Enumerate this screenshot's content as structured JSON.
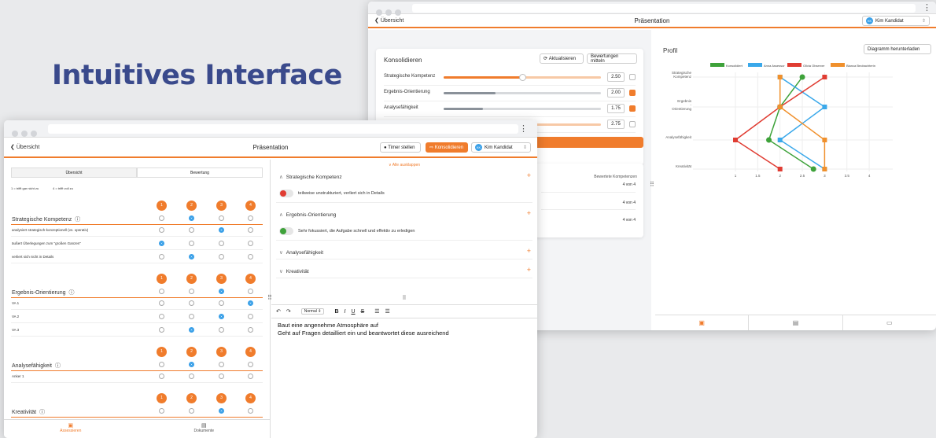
{
  "hero_title": "Intuitives Interface",
  "back_win": {
    "back_label": "Übersicht",
    "title": "Präsentation",
    "candidate": "Kim Kandidat",
    "candidate_initials": "KK",
    "konsolidieren": {
      "heading": "Konsolidieren",
      "btn_update": "Aktualisieren",
      "btn_average": "Bewertungen mitteln",
      "rows": [
        {
          "label": "Strategische Kompetenz",
          "value": "2.50",
          "checked": false,
          "fill": 0.5
        },
        {
          "label": "Ergebnis-Orientierung",
          "value": "2.00",
          "checked": true,
          "fill": 0.33
        },
        {
          "label": "Analysefähigkeit",
          "value": "1.75",
          "checked": true,
          "fill": 0.25
        },
        {
          "label": "",
          "value": "2.75",
          "checked": false,
          "fill": 0.58
        }
      ]
    },
    "bewertete_label": "Bewertete Kompetenzen",
    "counts": [
      "4 von 4",
      "4 von 4",
      "4 von 4"
    ],
    "profil": {
      "heading": "Profil",
      "download": "Diagramm herunterladen"
    }
  },
  "chart_data": {
    "type": "line",
    "orientation": "horizontal",
    "categories": [
      "Strategische Kompetenz",
      "Ergebnis - Orientierung",
      "Analysefähigkeit",
      "Kreativität"
    ],
    "x_ticks": [
      "1",
      "1.5",
      "2",
      "2.5",
      "3",
      "3.5",
      "4"
    ],
    "xlim": [
      1,
      4
    ],
    "legend_position": "top",
    "series": [
      {
        "name": "Konsolidiert",
        "color": "#3ea23a",
        "values": [
          2.5,
          2,
          1.75,
          2.75
        ]
      },
      {
        "name": "Anna Assessor",
        "color": "#3aa8ea",
        "values": [
          2,
          3,
          2,
          3
        ]
      },
      {
        "name": "Olivia Observer",
        "color": "#e03c32",
        "values": [
          3,
          2,
          1,
          2
        ]
      },
      {
        "name": "Bianca Beobachterin",
        "color": "#f0902c",
        "values": [
          2,
          2,
          3,
          3
        ]
      }
    ]
  },
  "front_win": {
    "back_label": "Übersicht",
    "title": "Präsentation",
    "timer": "Timer stellen",
    "konsolidieren": "Konsolidieren",
    "candidate": "Kim Kandidat",
    "candidate_initials": "KK",
    "tabs": [
      "Übersicht",
      "Bewertung"
    ],
    "scale_low": "1 = trifft gar nicht zu",
    "scale_high": "4 = trifft voll zu",
    "nums": [
      "1",
      "2",
      "3",
      "4"
    ],
    "groups": [
      {
        "title": "Strategische Kompetenz",
        "sel": 1,
        "rows": [
          {
            "label": "analysiert strategisch-konzeptionell (vs. operativ)",
            "sel": 2
          },
          {
            "label": "äußert Überlegungen zum \"großen Ganzen\"",
            "sel": 0
          },
          {
            "label": "verliert sich nicht in Details",
            "sel": 1
          }
        ]
      },
      {
        "title": "Ergebnis-Orientierung",
        "sel": 2,
        "rows": [
          {
            "label": "VA 1",
            "sel": 3
          },
          {
            "label": "VA 2",
            "sel": 2
          },
          {
            "label": "VA 3",
            "sel": 1
          }
        ]
      },
      {
        "title": "Analysefähigkeit",
        "sel": 1,
        "rows": [
          {
            "label": "Anker 1",
            "sel": -1
          }
        ]
      },
      {
        "title": "Kreativität",
        "sel": 2,
        "rows": []
      }
    ],
    "collapse_all": "Alle ausklappen",
    "sections": [
      {
        "title": "Strategische Kompetenz",
        "note": "teilweise unstrukturiert, verliert sich in Details",
        "note_color": "#e03c32"
      },
      {
        "title": "Ergebnis-Orientierung",
        "note": "Sehr fokussiert, die Aufgabe schnell und effektiv zu erledigen",
        "note_color": "#3ea23a"
      },
      {
        "title": "Analysefähigkeit",
        "note": "",
        "note_color": ""
      },
      {
        "title": "Kreativität",
        "note": "",
        "note_color": ""
      }
    ],
    "editor_style": "Normal",
    "editor_lines": [
      "Baut eine angenehme Atmosphäre auf",
      "Geht auf Fragen detailliert ein und beantwortet diese ausreichend"
    ],
    "bottom_tabs": [
      "Assessieren",
      "Dokumente"
    ]
  }
}
